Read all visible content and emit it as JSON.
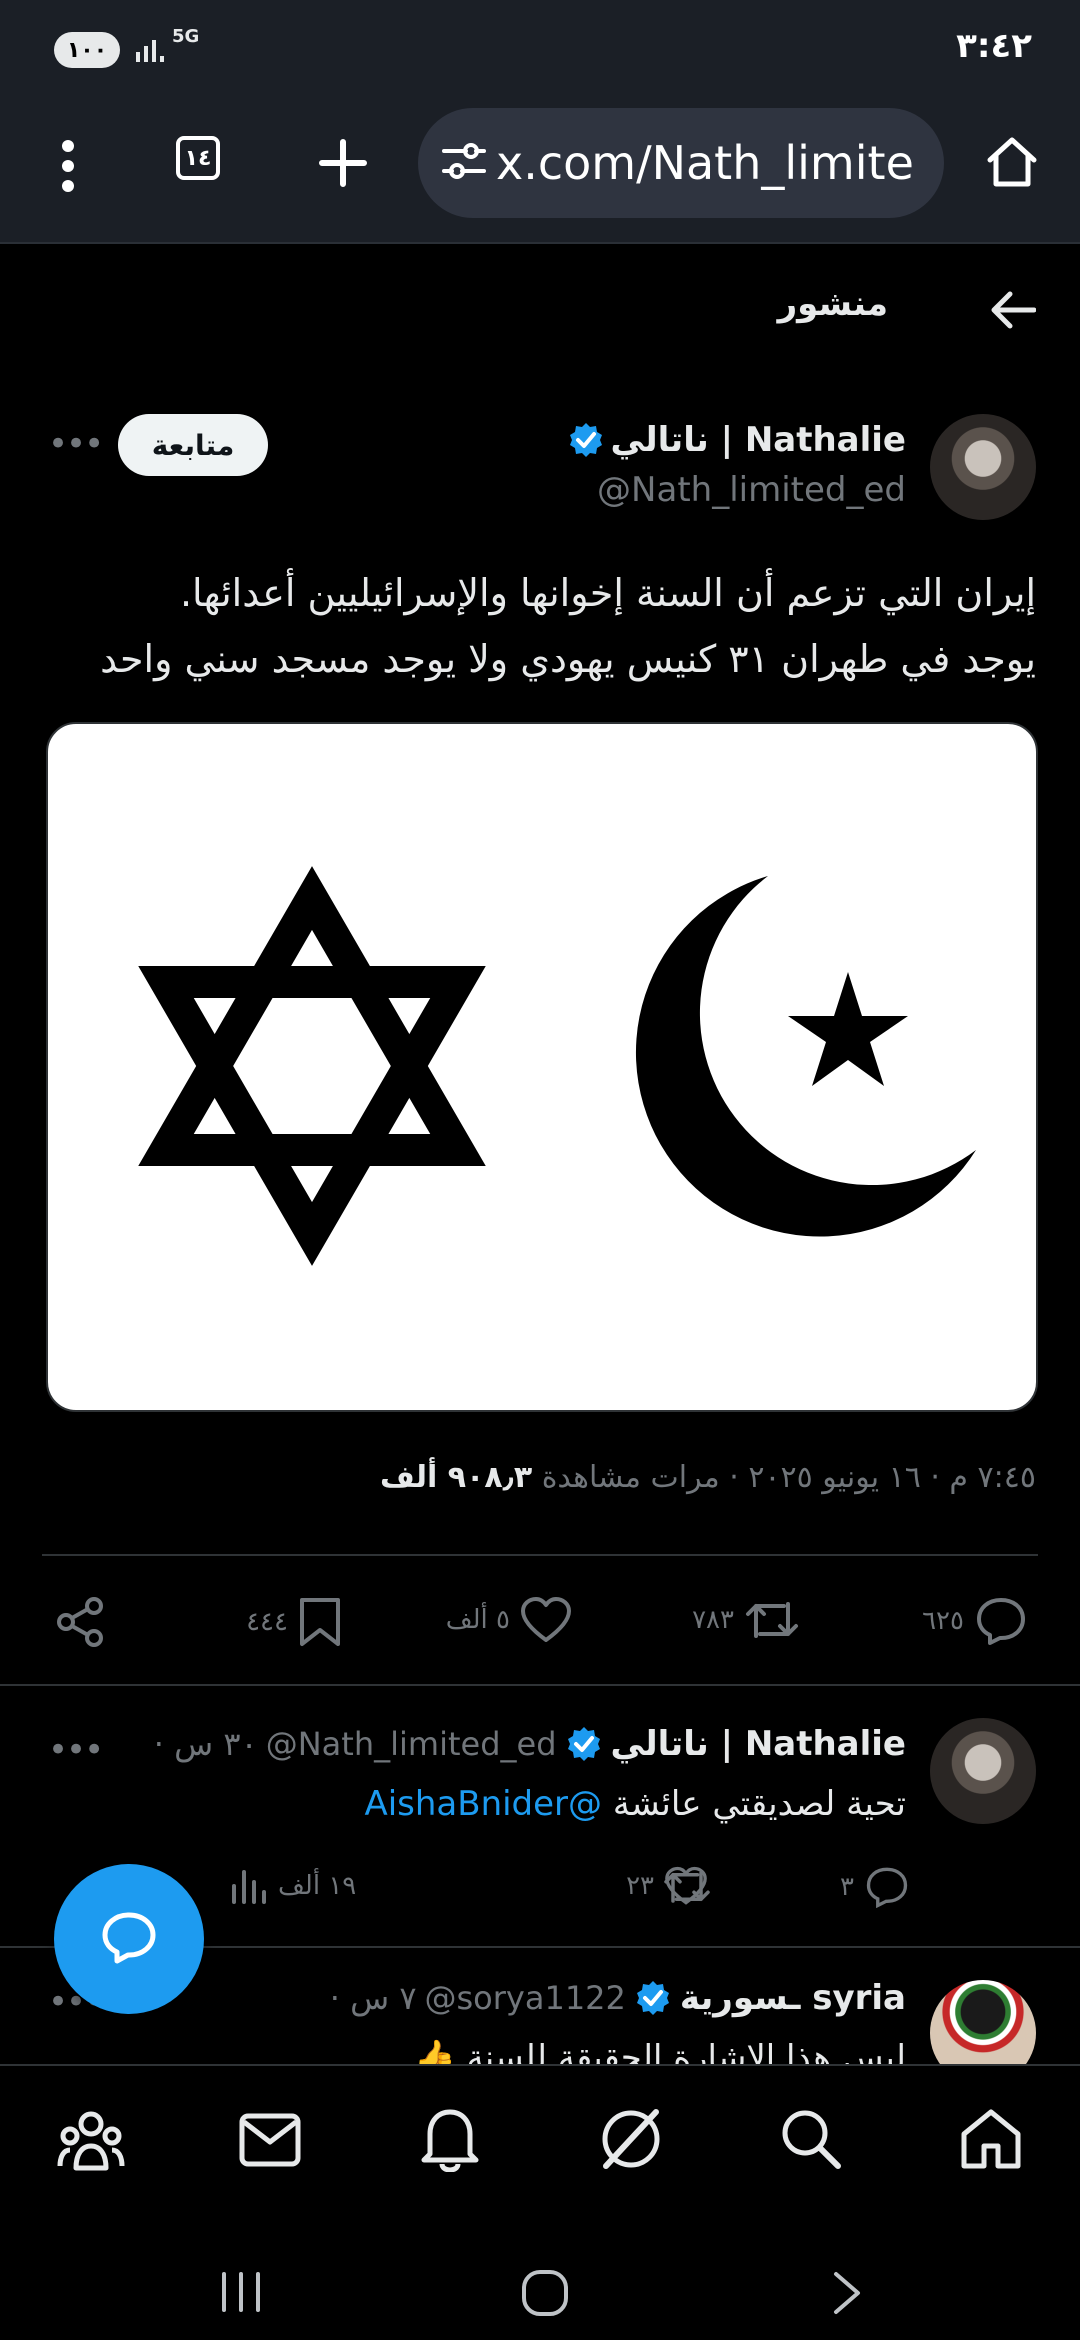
{
  "status_bar": {
    "battery": "١٠٠",
    "network": "5G",
    "time": "٣:٤٢"
  },
  "browser": {
    "url": "x.com/Nath_limite",
    "tab_count": "١٤"
  },
  "header": {
    "title": "منشور"
  },
  "post": {
    "author_name": "ناتالي | Nathalie",
    "author_handle": "@Nath_limited_ed",
    "follow_label": "متابعة",
    "text_line1": "إيران التي تزعم أن السنة إخوانها والإسرائيليين أعدائها.",
    "text_line2": "يوجد في طهران ٣١ كنيس يهودي ولا يوجد مسجد سني واحد",
    "meta_prefix": "٧:٤٥ م · ١٦ يونيو ٢٠٢٥ · ",
    "views_value": "٩٠٨٫٣ ألف",
    "views_label": " مرات مشاهدة",
    "replies": "٦٢٥",
    "reposts": "٧٨٣",
    "likes": "٥ ألف",
    "bookmarks": "٤٤٤"
  },
  "reply1": {
    "author_name": "ناتالي | Nathalie",
    "author_handle": "@Nath_limited_ed",
    "time": "· ٣٠ س",
    "text": "تحية لصديقتي عائشة",
    "mention": "@AishaBnider",
    "replies": "٣",
    "likes": "٢٣",
    "views": "١٩ ألف"
  },
  "reply2": {
    "author_name": "ـسورية syria",
    "author_handle": "@sorya1122",
    "time": "· ٧ س",
    "text_partial": "ليس هذا الاشارة الحقيقة للسنة 👍"
  },
  "icons": {
    "accent": "#1d9bf0"
  }
}
